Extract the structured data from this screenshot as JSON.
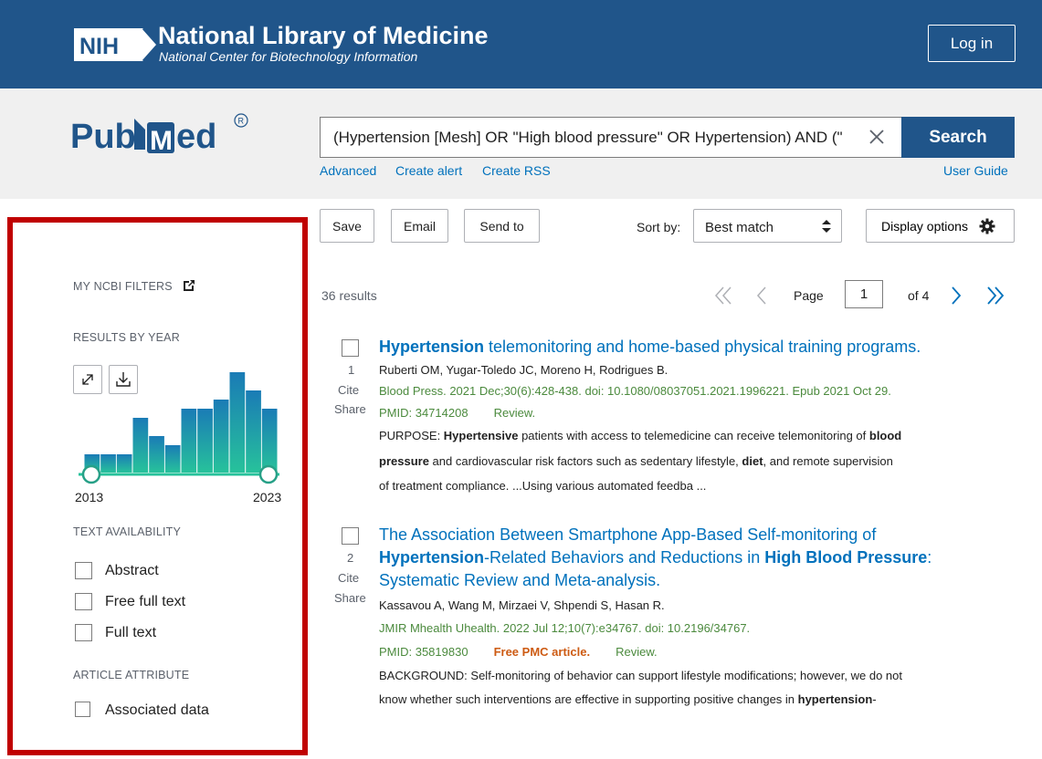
{
  "header": {
    "logo_text": "NIH",
    "title": "National Library of Medicine",
    "subtitle": "National Center for Biotechnology Information",
    "login_label": "Log in"
  },
  "search": {
    "logo_text": "PubMed",
    "query": "(Hypertension [Mesh] OR \"High blood pressure\" OR Hypertension) AND (\"",
    "search_label": "Search",
    "links": {
      "advanced": "Advanced",
      "create_alert": "Create alert",
      "create_rss": "Create RSS",
      "user_guide": "User Guide"
    }
  },
  "toolbar": {
    "save_label": "Save",
    "email_label": "Email",
    "send_to_label": "Send to",
    "sort_label": "Sort by:",
    "sort_value": "Best match",
    "display_label": "Display options"
  },
  "sidebar": {
    "my_filters": "MY NCBI FILTERS",
    "results_by_year": "RESULTS BY YEAR",
    "year_start": "2013",
    "year_end": "2023",
    "chart_values": [
      2,
      2,
      2,
      6,
      4,
      3,
      7,
      7,
      8,
      11,
      9,
      7
    ],
    "text_availability": "TEXT AVAILABILITY",
    "text_options": [
      "Abstract",
      "Free full text",
      "Full text"
    ],
    "article_attribute": "ARTICLE ATTRIBUTE",
    "attribute_options": [
      "Associated data"
    ]
  },
  "results": {
    "count": "36 results",
    "page_label": "Page",
    "page_current": "1",
    "page_of": "of 4",
    "cite_label": "Cite",
    "share_label": "Share",
    "items": [
      {
        "num": "1",
        "title_bold": "Hypertension",
        "title_rest": " telemonitoring and home-based physical training programs.",
        "authors": "Ruberti OM, Yugar-Toledo JC, Moreno H, Rodrigues B.",
        "citation": "Blood Press. 2021 Dec;30(6):428-438. doi: 10.1080/08037051.2021.1996221. Epub 2021 Oct 29.",
        "pmid": "PMID: 34714208",
        "review": "Review.",
        "snippet_lines": [
          [
            "PURPOSE: ",
            "Hypertensive",
            " patients with access to telemedicine can receive telemonitoring of ",
            "blood",
            ""
          ],
          [
            "",
            "pressure",
            " and cardiovascular risk factors such as sedentary lifestyle, ",
            "diet",
            ", and remote supervision"
          ],
          [
            "of treatment compliance. ...Using various automated feedba ...",
            "",
            "",
            "",
            ""
          ]
        ]
      },
      {
        "num": "2",
        "title_line1": "The Association Between Smartphone App-Based Self-monitoring of",
        "title_line2_bold": "Hypertension",
        "title_line2_mid": "-Related Behaviors and Reductions in ",
        "title_line2_bold2": "High Blood Pressure",
        "title_line2_end": ":",
        "title_line3": "Systematic Review and Meta-analysis.",
        "authors": "Kassavou A, Wang M, Mirzaei V, Shpendi S, Hasan R.",
        "citation": "JMIR Mhealth Uhealth. 2022 Jul 12;10(7):e34767. doi: 10.2196/34767.",
        "pmid": "PMID: 35819830",
        "free_pmc": "Free PMC article.",
        "review": "Review.",
        "snippet_lines": [
          [
            "BACKGROUND: Self-monitoring of behavior can support lifestyle modifications; however, we do not",
            "",
            "",
            "",
            ""
          ],
          [
            "know whether such interventions are effective in supporting positive changes in ",
            "hypertension",
            "-",
            "",
            ""
          ]
        ]
      }
    ]
  },
  "colors": {
    "nih_blue": "#20558a",
    "link_blue": "#0071bc",
    "highlight_red": "#c00000",
    "bar_teal": "#20b39a"
  },
  "icons": [
    "external-link-icon",
    "expand-icon",
    "download-icon",
    "clear-icon",
    "sort-arrows-icon",
    "gear-icon",
    "first-page-icon",
    "prev-page-icon",
    "next-page-icon",
    "last-page-icon"
  ]
}
